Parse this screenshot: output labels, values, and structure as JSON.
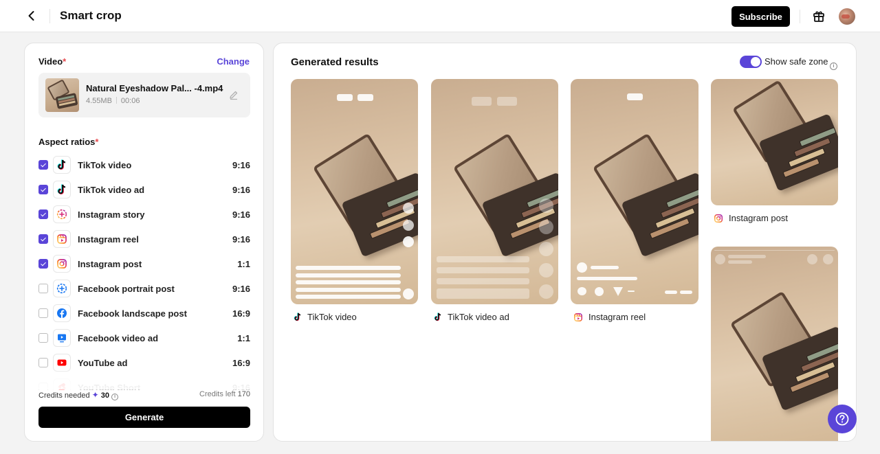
{
  "header": {
    "title": "Smart crop",
    "subscribe_label": "Subscribe",
    "back_icon": "chevron-left-icon",
    "gift_icon": "gift-icon"
  },
  "left": {
    "video_label": "Video",
    "required_mark": "*",
    "change_label": "Change",
    "video": {
      "name": "Natural Eyeshadow Pal... -4.mp4",
      "size": "4.55MB",
      "duration": "00:06"
    },
    "aspect_label": "Aspect ratios",
    "ratios": [
      {
        "name": "TikTok video",
        "ratio": "9:16",
        "checked": true,
        "icon": "tiktok-icon"
      },
      {
        "name": "TikTok video ad",
        "ratio": "9:16",
        "checked": true,
        "icon": "tiktok-icon"
      },
      {
        "name": "Instagram story",
        "ratio": "9:16",
        "checked": true,
        "icon": "instagram-story-icon"
      },
      {
        "name": "Instagram reel",
        "ratio": "9:16",
        "checked": true,
        "icon": "instagram-reel-icon"
      },
      {
        "name": "Instagram post",
        "ratio": "1:1",
        "checked": true,
        "icon": "instagram-icon"
      },
      {
        "name": "Facebook portrait post",
        "ratio": "9:16",
        "checked": false,
        "icon": "facebook-story-icon"
      },
      {
        "name": "Facebook landscape post",
        "ratio": "16:9",
        "checked": false,
        "icon": "facebook-icon"
      },
      {
        "name": "Facebook video ad",
        "ratio": "1:1",
        "checked": false,
        "icon": "facebook-video-icon"
      },
      {
        "name": "YouTube ad",
        "ratio": "16:9",
        "checked": false,
        "icon": "youtube-icon"
      },
      {
        "name": "YouTube Short",
        "ratio": "9:16",
        "checked": false,
        "icon": "youtube-shorts-icon"
      }
    ],
    "credits_needed_label": "Credits needed",
    "credits_needed_value": "30",
    "credits_left_label": "Credits left",
    "credits_left_value": "170",
    "generate_label": "Generate"
  },
  "right": {
    "title": "Generated results",
    "safe_zone_label": "Show safe zone",
    "safe_zone_on": true,
    "results": [
      {
        "label": "TikTok video",
        "icon": "tiktok-icon"
      },
      {
        "label": "TikTok video ad",
        "icon": "tiktok-icon"
      },
      {
        "label": "Instagram reel",
        "icon": "instagram-reel-icon"
      },
      {
        "label": "Instagram post",
        "icon": "instagram-icon"
      },
      {
        "label": "",
        "icon": ""
      }
    ]
  },
  "colors": {
    "accent": "#5a45d8",
    "required": "#e5484d",
    "primary_button": "#000000"
  }
}
